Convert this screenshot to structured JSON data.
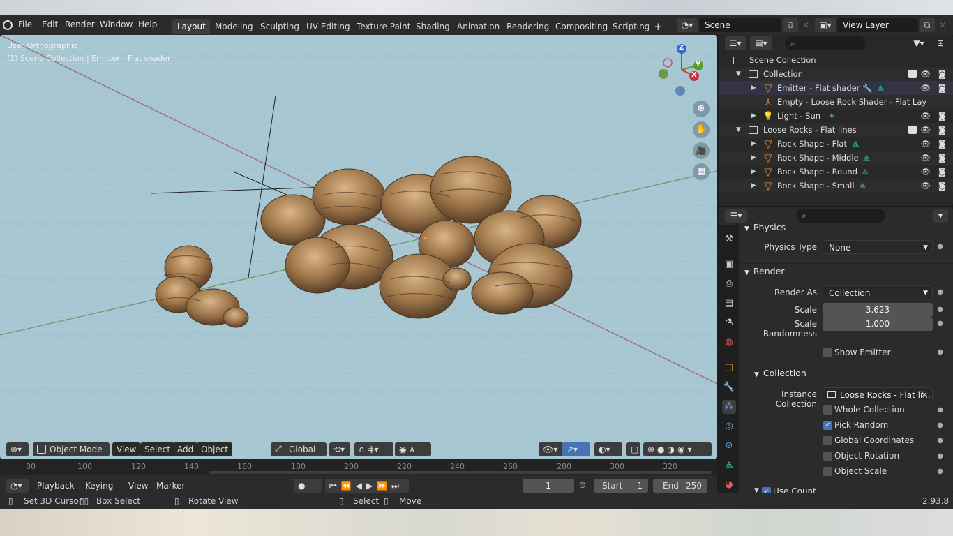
{
  "topbar": {
    "menus": [
      "File",
      "Edit",
      "Render",
      "Window",
      "Help"
    ],
    "workspaces": [
      "Layout",
      "Modeling",
      "Sculpting",
      "UV Editing",
      "Texture Paint",
      "Shading",
      "Animation",
      "Rendering",
      "Compositing",
      "Scripting"
    ],
    "active_workspace": "Layout",
    "add_tab_glyph": "+",
    "scene_name": "Scene",
    "view_layer": "View Layer"
  },
  "viewport": {
    "view_name": "User Orthographic",
    "context_line": "(1) Scene Collection | Emitter - Flat shader",
    "mode": "Object Mode",
    "menus": [
      "View",
      "Select",
      "Add",
      "Object"
    ],
    "transform_orientation": "Global",
    "gizmo_axes": {
      "z": "Z",
      "y": "Y",
      "x": "X"
    }
  },
  "timeline": {
    "ticks": [
      "80",
      "100",
      "120",
      "140",
      "160",
      "180",
      "200",
      "220",
      "240",
      "260",
      "280",
      "300",
      "320"
    ],
    "menus": [
      "Playback",
      "Keying",
      "View",
      "Marker"
    ],
    "current_frame": "1",
    "start_label": "Start",
    "start": "1",
    "end_label": "End",
    "end": "250"
  },
  "statusbar": {
    "items": [
      "Set 3D Cursor",
      "Box Select",
      "Rotate View",
      "Select",
      "Move"
    ],
    "version": "2.93.8"
  },
  "outliner": {
    "rows": [
      {
        "label": "Scene Collection",
        "icon": "scene-collection-icon"
      },
      {
        "label": "Collection",
        "icon": "collection-icon"
      },
      {
        "label": "Emitter - Flat shader",
        "icon": "mesh-icon"
      },
      {
        "label": "Empty - Loose Rock Shader - Flat Lay",
        "icon": "empty-icon"
      },
      {
        "label": "Light - Sun",
        "icon": "light-icon"
      },
      {
        "label": "Loose Rocks - Flat lines",
        "icon": "collection-icon"
      },
      {
        "label": "Rock Shape - Flat",
        "icon": "mesh-icon"
      },
      {
        "label": "Rock Shape - Middle",
        "icon": "mesh-icon"
      },
      {
        "label": "Rock Shape - Round",
        "icon": "mesh-icon"
      },
      {
        "label": "Rock Shape - Small",
        "icon": "mesh-icon"
      }
    ]
  },
  "properties": {
    "physics_header": "Physics",
    "physics_type_label": "Physics Type",
    "physics_type": "None",
    "render_header": "Render",
    "render_as_label": "Render As",
    "render_as": "Collection",
    "scale_label": "Scale",
    "scale": "3.623",
    "scale_random_label": "Scale Randomness",
    "scale_random": "1.000",
    "show_emitter": "Show Emitter",
    "collection_header": "Collection",
    "instance_collection_label": "Instance Collection",
    "instance_collection": "Loose Rocks - Flat li...",
    "whole_collection": "Whole Collection",
    "pick_random": "Pick Random",
    "global_coords": "Global Coordinates",
    "object_rotation": "Object Rotation",
    "object_scale": "Object Scale",
    "use_count": "Use Count"
  },
  "colors": {
    "accent": "#4772b3",
    "viewport_bg": "#a6c6d2",
    "rock": "#a07a4e",
    "mesh_icon": "#e0913a",
    "particle_icon": "#2fd39a"
  }
}
